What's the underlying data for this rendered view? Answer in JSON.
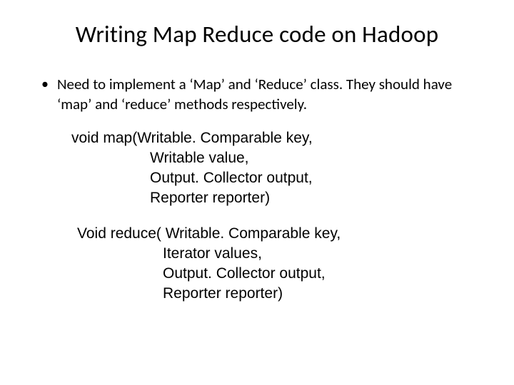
{
  "title": "Writing Map Reduce code on Hadoop",
  "bullet": {
    "dot": "•",
    "text": "Need to implement a ‘Map’ and ‘Reduce’ class. They should have ‘map’ and ‘reduce’ methods respectively."
  },
  "map_code": {
    "l1": "void map(Writable. Comparable key,",
    "l2": "Writable value,",
    "l3": "Output. Collector output,",
    "l4": "Reporter reporter)"
  },
  "reduce_code": {
    "l1": "Void reduce( Writable. Comparable key,",
    "l2": "Iterator values,",
    "l3": "Output. Collector output,",
    "l4": "Reporter reporter)"
  }
}
